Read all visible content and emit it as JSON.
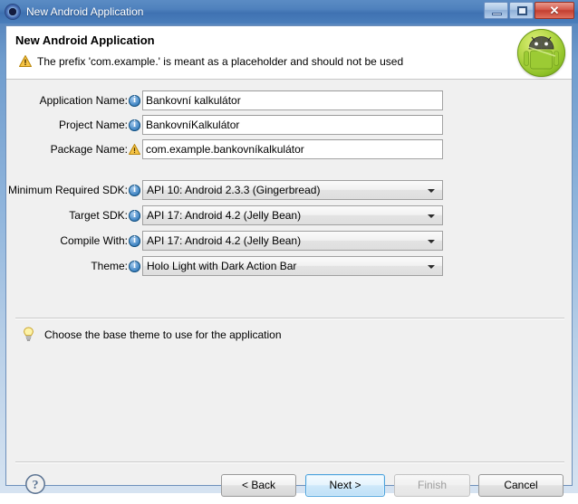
{
  "window": {
    "title": "New Android Application",
    "icon": "android-sdk-gear-icon",
    "controls": {
      "minimize": "minimize-icon",
      "maximize": "maximize-icon",
      "close": "✕"
    }
  },
  "header": {
    "title": "New Android Application",
    "message": "The prefix 'com.example.' is meant as a placeholder and should not be used",
    "message_icon": "warning-icon",
    "logo": "android-robot-logo"
  },
  "form": {
    "fields": [
      {
        "label": "Application Name:",
        "badge": "info",
        "type": "text",
        "value": "Bankovní kalkulátor",
        "name": "application-name"
      },
      {
        "label": "Project Name:",
        "badge": "info",
        "type": "text",
        "value": "BankovníKalkulátor",
        "name": "project-name"
      },
      {
        "label": "Package Name:",
        "badge": "warn",
        "type": "text",
        "value": "com.example.bankovníkalkulátor",
        "name": "package-name"
      },
      {
        "label": "Minimum Required SDK:",
        "badge": "info",
        "type": "combo",
        "value": "API 10: Android 2.3.3 (Gingerbread)",
        "name": "minimum-required-sdk"
      },
      {
        "label": "Target SDK:",
        "badge": "info",
        "type": "combo",
        "value": "API 17: Android 4.2 (Jelly Bean)",
        "name": "target-sdk"
      },
      {
        "label": "Compile With:",
        "badge": "info",
        "type": "combo",
        "value": "API 17: Android 4.2 (Jelly Bean)",
        "name": "compile-with"
      },
      {
        "label": "Theme:",
        "badge": "info",
        "type": "combo",
        "value": "Holo Light with Dark Action Bar",
        "name": "theme"
      }
    ]
  },
  "hint": {
    "icon": "lightbulb-icon",
    "text": "Choose the base theme to use for the application"
  },
  "buttons": {
    "help": "?",
    "back": "< Back",
    "next": "Next >",
    "finish": "Finish",
    "cancel": "Cancel"
  },
  "colors": {
    "titlebar": "#4f81bd",
    "dialog_bg": "#f0f0f0",
    "header_bg": "#ffffff",
    "accent_focus": "#4da3dd",
    "warning": "#e8a317",
    "info": "#1d5a96",
    "android_green": "#8ec127",
    "close_red": "#c33f30"
  }
}
